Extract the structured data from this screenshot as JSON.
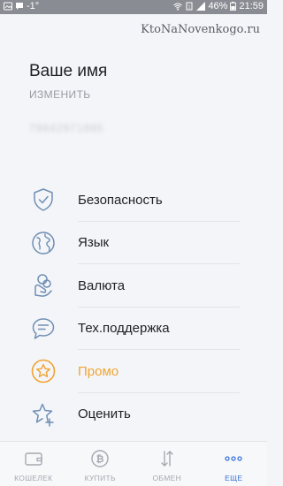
{
  "status_bar": {
    "left_text": "-1°",
    "battery": "46%",
    "time": "21:59"
  },
  "watermark": "KtoNaNovenkogo.ru",
  "profile": {
    "name": "Ваше имя",
    "edit_label": "ИЗМЕНИТЬ",
    "phone": "79642971885"
  },
  "menu": {
    "items": [
      {
        "label": "Безопасность",
        "icon": "shield-check-icon"
      },
      {
        "label": "Язык",
        "icon": "globe-icon"
      },
      {
        "label": "Валюта",
        "icon": "coins-hand-icon"
      },
      {
        "label": "Тех.поддержка",
        "icon": "chat-bubble-icon"
      },
      {
        "label": "Промо",
        "icon": "star-circle-icon",
        "color": "#f0a433"
      },
      {
        "label": "Оценить",
        "icon": "star-plus-icon"
      }
    ]
  },
  "bottom_nav": {
    "items": [
      {
        "label": "КОШЕЛЕК",
        "icon": "wallet-icon"
      },
      {
        "label": "КУПИТЬ",
        "icon": "bitcoin-icon"
      },
      {
        "label": "ОБМЕН",
        "icon": "exchange-arrows-icon"
      },
      {
        "label": "ЕЩЕ",
        "icon": "more-dots-icon",
        "active": true
      }
    ]
  },
  "colors": {
    "accent_blue": "#3a73d8",
    "promo_orange": "#f0a433",
    "icon_blue": "#6f8fb5"
  }
}
